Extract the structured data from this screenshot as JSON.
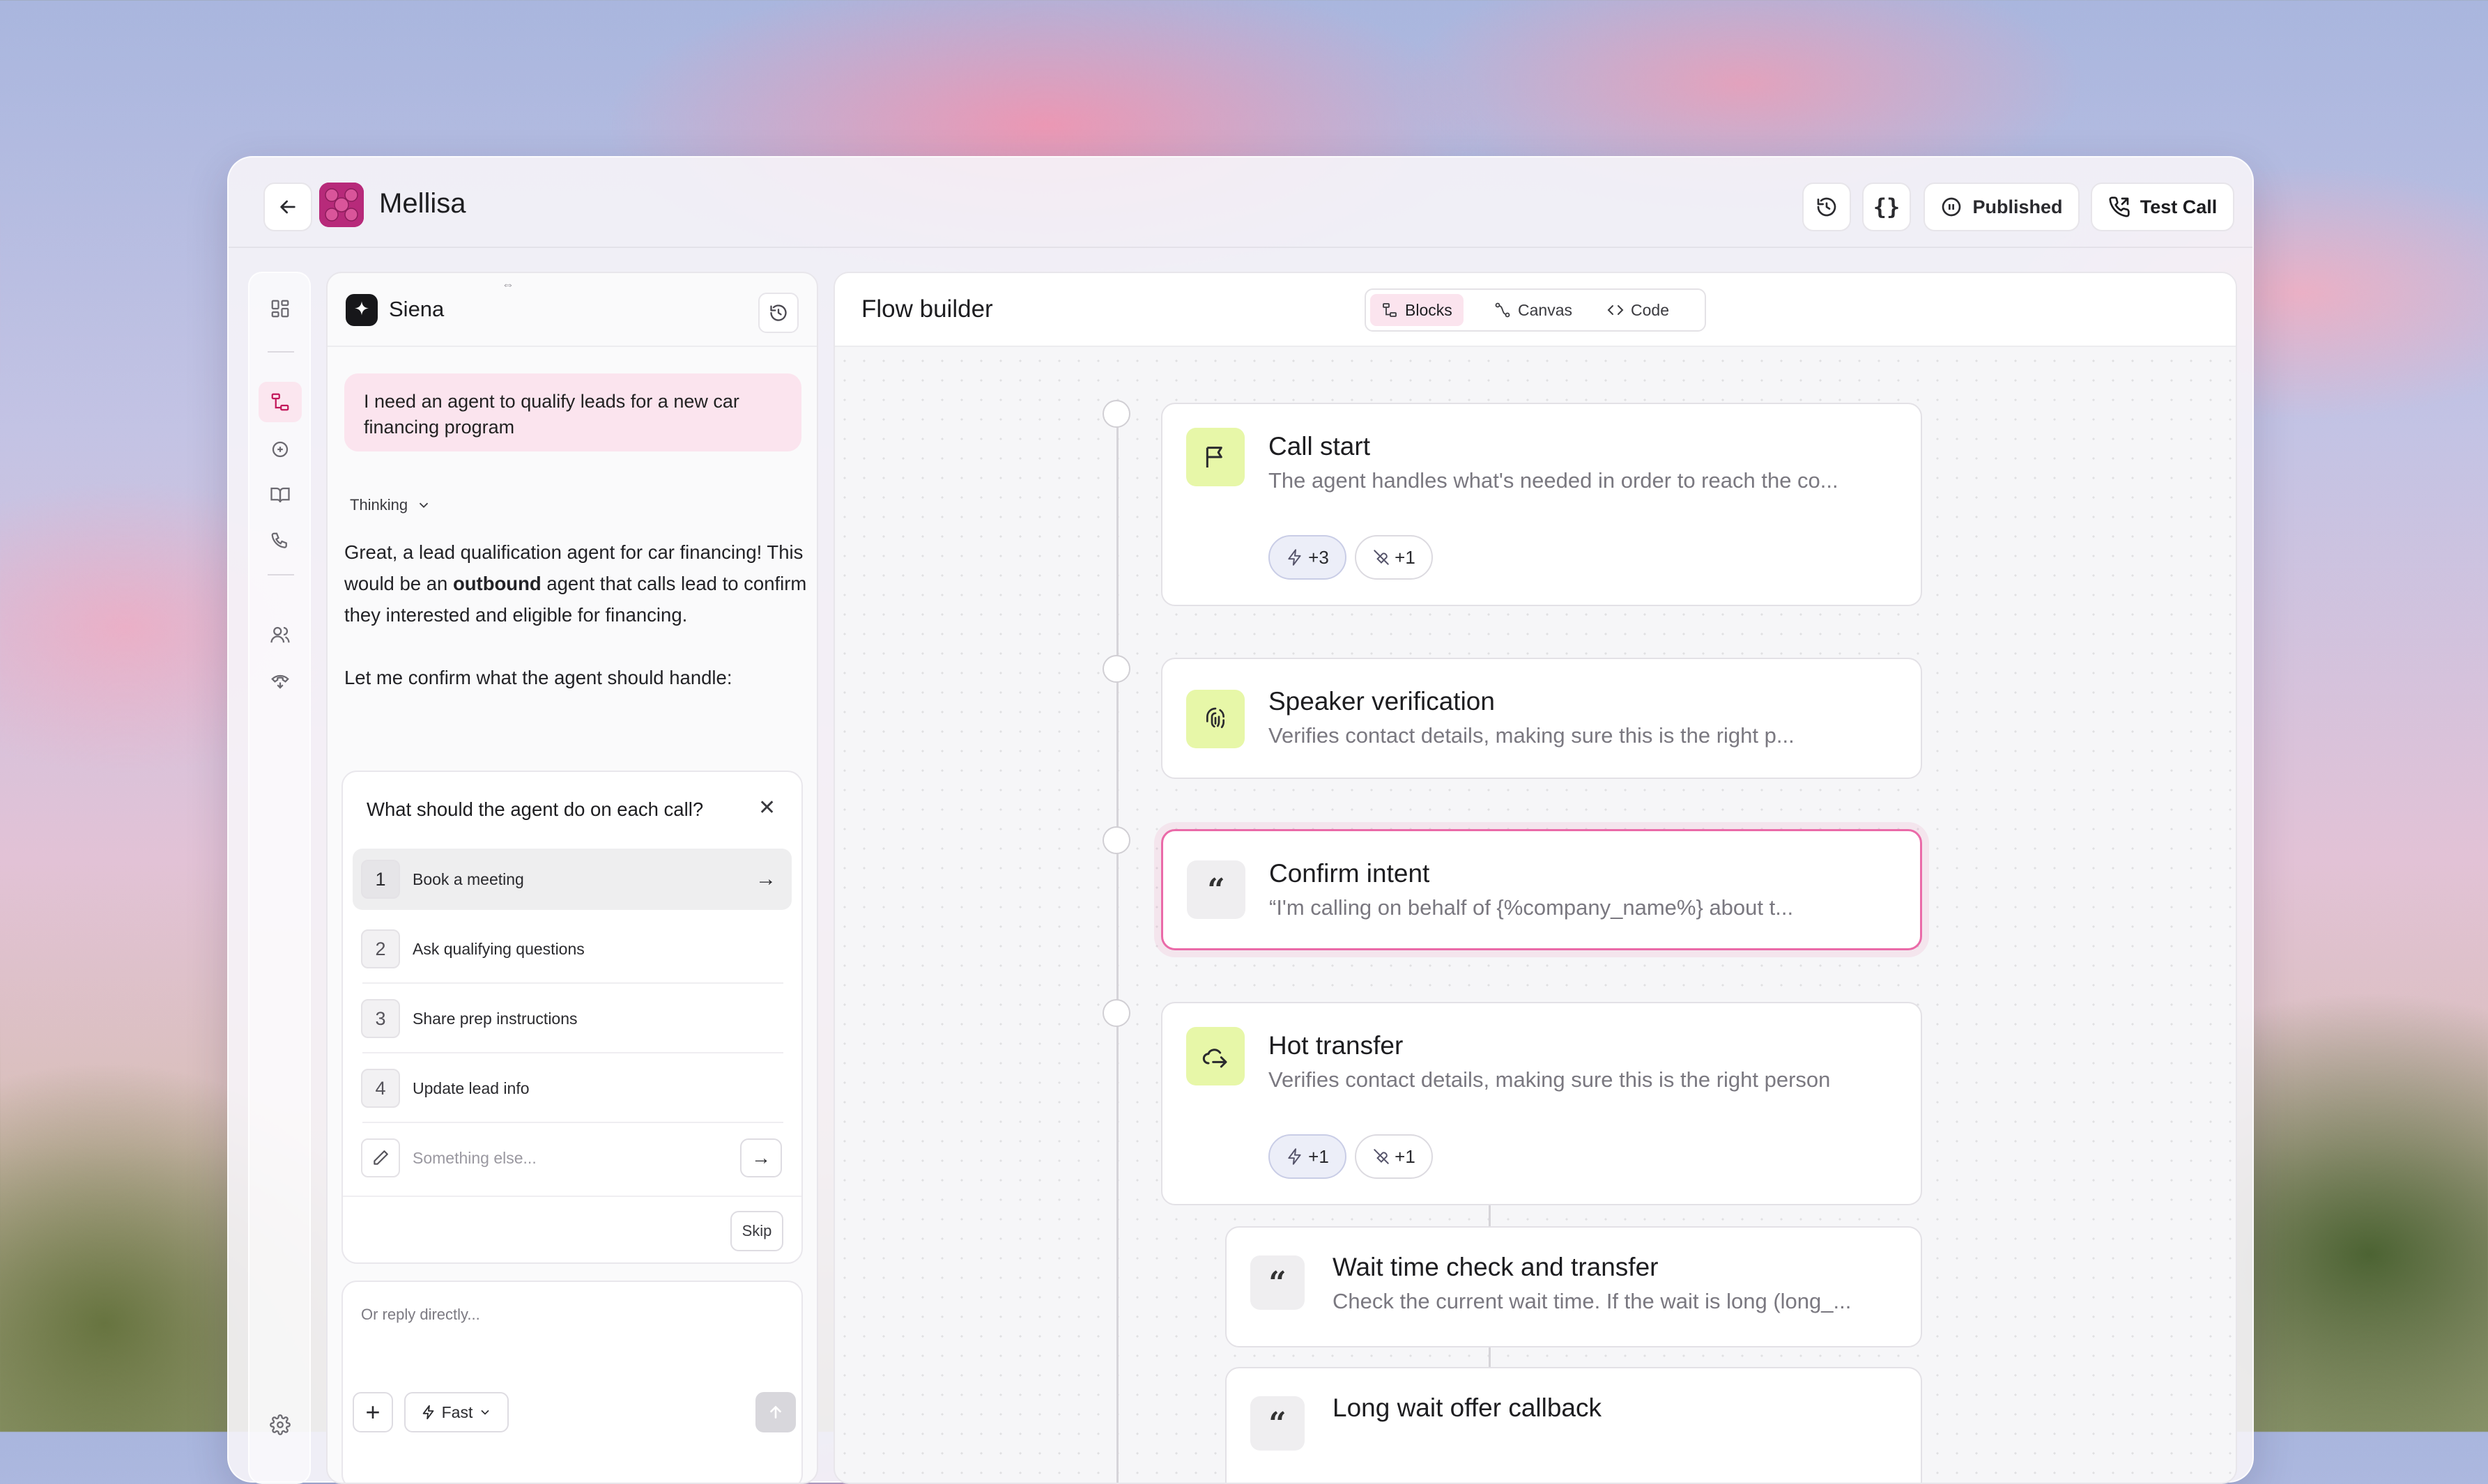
{
  "app": {
    "title": "Mellisa"
  },
  "header": {
    "published_label": "Published",
    "test_call_label": "Test Call"
  },
  "assistant": {
    "name": "Siena",
    "user_message": "I need an agent to qualify leads for a new car financing program",
    "thinking_label": "Thinking",
    "reply_line1_a": "Great, a lead qualification agent for car financing! This would be an ",
    "reply_line1_bold": "outbound",
    "reply_line1_b": " agent that calls lead to confirm they interested and eligible for financing.",
    "reply_line2": "Let me confirm what the agent should handle:"
  },
  "question": {
    "title": "What should the agent do on each call?",
    "options": [
      {
        "num": "1",
        "label": "Book a meeting"
      },
      {
        "num": "2",
        "label": "Ask qualifying questions"
      },
      {
        "num": "3",
        "label": "Share prep instructions"
      },
      {
        "num": "4",
        "label": "Update lead info"
      }
    ],
    "other_placeholder": "Something else...",
    "skip_label": "Skip"
  },
  "composer": {
    "placeholder": "Or reply directly...",
    "mode_label": "Fast"
  },
  "flow": {
    "title": "Flow builder",
    "tabs": [
      {
        "label": "Blocks"
      },
      {
        "label": "Canvas"
      },
      {
        "label": "Code"
      }
    ],
    "blocks": [
      {
        "title": "Call start",
        "desc": "The agent handles what's needed in order to reach the co...",
        "chip_actions": "+3",
        "chip_tools": "+1"
      },
      {
        "title": "Speaker verification",
        "desc": "Verifies contact details, making sure this is the right p..."
      },
      {
        "title": "Confirm intent",
        "desc": "“I'm calling on behalf of {%company_name%} about t..."
      },
      {
        "title": "Hot transfer",
        "desc": "Verifies contact details, making sure this is the right person",
        "chip_actions": "+1",
        "chip_tools": "+1"
      },
      {
        "title": "Wait time check and transfer",
        "desc": "Check the current wait time. If the wait is long (long_..."
      },
      {
        "title": "Long wait offer callback",
        "desc": ""
      }
    ]
  },
  "colors": {
    "accent_pink": "#ea6aa8",
    "brand_magenta": "#b72a7a",
    "block_icon_green": "#e7f7a8"
  }
}
